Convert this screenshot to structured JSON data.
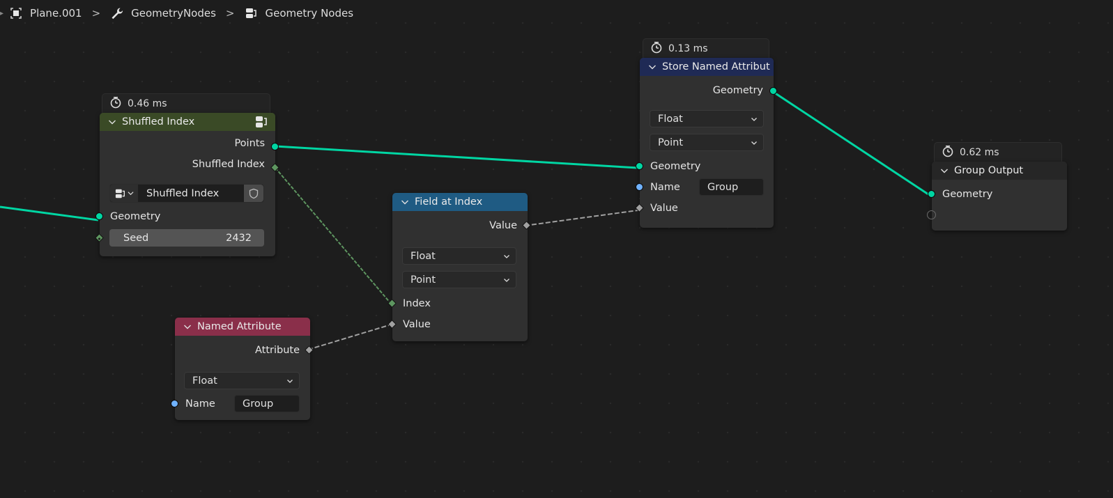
{
  "breadcrumb": {
    "items": [
      {
        "label": "Plane.001",
        "icon": "object-icon"
      },
      {
        "label": "GeometryNodes",
        "icon": "wrench-icon"
      },
      {
        "label": "Geometry Nodes",
        "icon": "node-tree-icon"
      }
    ],
    "separator": ">"
  },
  "colors": {
    "geometry_link": "#00d6a3",
    "int_link": "#5e9660",
    "float_link": "#a1a1a1",
    "header_shuffled": "#3a4a26",
    "header_store": "#1f2a55",
    "header_field": "#1f5b83",
    "header_named": "#8a2f4a",
    "header_output": "#262626"
  },
  "nodes": {
    "shuffled_index": {
      "timer": "0.46 ms",
      "title": "Shuffled Index",
      "outputs": [
        "Points",
        "Shuffled Index"
      ],
      "group_selector": "Shuffled Index",
      "inputs": {
        "geometry": "Geometry",
        "seed_label": "Seed",
        "seed_value": "2432"
      }
    },
    "store_named_attribute": {
      "timer": "0.13 ms",
      "title": "Store Named Attribut",
      "output": "Geometry",
      "data_type": "Float",
      "domain": "Point",
      "inputs": {
        "geometry": "Geometry",
        "name_label": "Name",
        "name_value": "Group",
        "value": "Value"
      }
    },
    "group_output": {
      "timer": "0.62 ms",
      "title": "Group Output",
      "inputs": {
        "geometry": "Geometry"
      }
    },
    "field_at_index": {
      "title": "Field at Index",
      "output": "Value",
      "data_type": "Float",
      "domain": "Point",
      "inputs": {
        "index": "Index",
        "value": "Value"
      }
    },
    "named_attribute": {
      "title": "Named Attribute",
      "output": "Attribute",
      "data_type": "Float",
      "inputs": {
        "name_label": "Name",
        "name_value": "Group"
      }
    }
  }
}
